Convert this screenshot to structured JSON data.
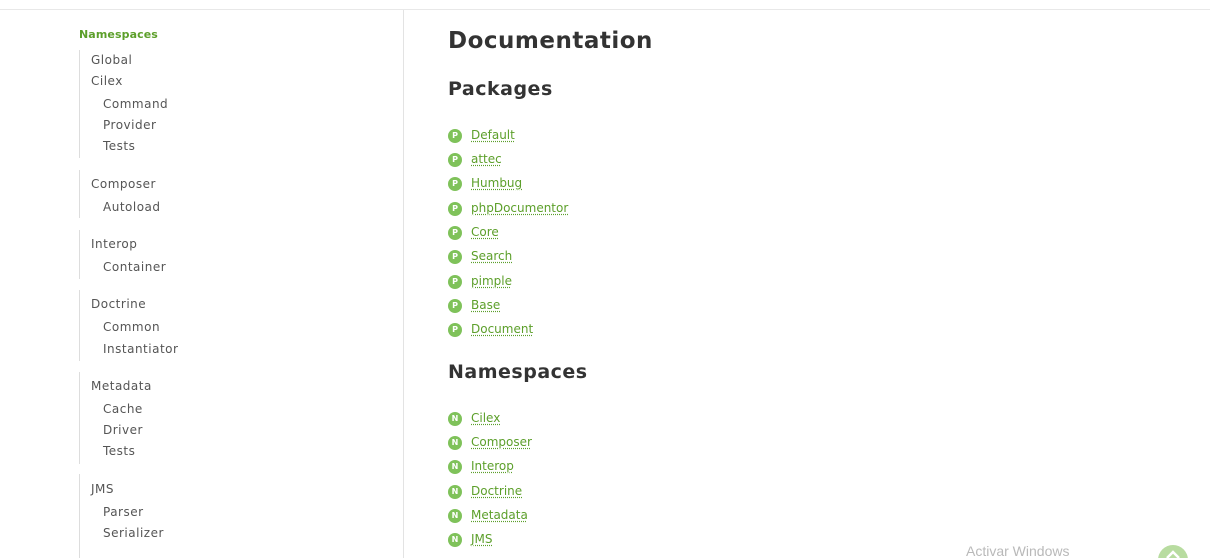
{
  "sidebar": {
    "heading": "Namespaces",
    "groups": [
      {
        "top": [
          "Global",
          "Cilex"
        ],
        "sub": [
          "Command",
          "Provider",
          "Tests"
        ]
      },
      {
        "top": [
          "Composer"
        ],
        "sub": [
          "Autoload"
        ]
      },
      {
        "top": [
          "Interop"
        ],
        "sub": [
          "Container"
        ]
      },
      {
        "top": [
          "Doctrine"
        ],
        "sub": [
          "Common",
          "Instantiator"
        ]
      },
      {
        "top": [
          "Metadata"
        ],
        "sub": [
          "Cache",
          "Driver",
          "Tests"
        ]
      },
      {
        "top": [
          "JMS"
        ],
        "sub": [
          "Parser",
          "Serializer"
        ]
      }
    ]
  },
  "main": {
    "title": "Documentation",
    "packages_heading": "Packages",
    "package_badge": "P",
    "packages": [
      "Default",
      "attec",
      "Humbug",
      "phpDocumentor",
      "Core",
      "Search",
      "pimple",
      "Base",
      "Document"
    ],
    "namespaces_heading": "Namespaces",
    "namespace_badge": "N",
    "namespaces": [
      "Cilex",
      "Composer",
      "Interop",
      "Doctrine",
      "Metadata",
      "JMS"
    ]
  },
  "overlay": {
    "watermark": "Activar Windows"
  },
  "colors": {
    "accent": "#5c9f2a",
    "badge": "#7fc25a"
  },
  "icons": {
    "package": "package-badge-icon",
    "namespace": "namespace-badge-icon",
    "scroll_top": "arrow-up-icon"
  }
}
